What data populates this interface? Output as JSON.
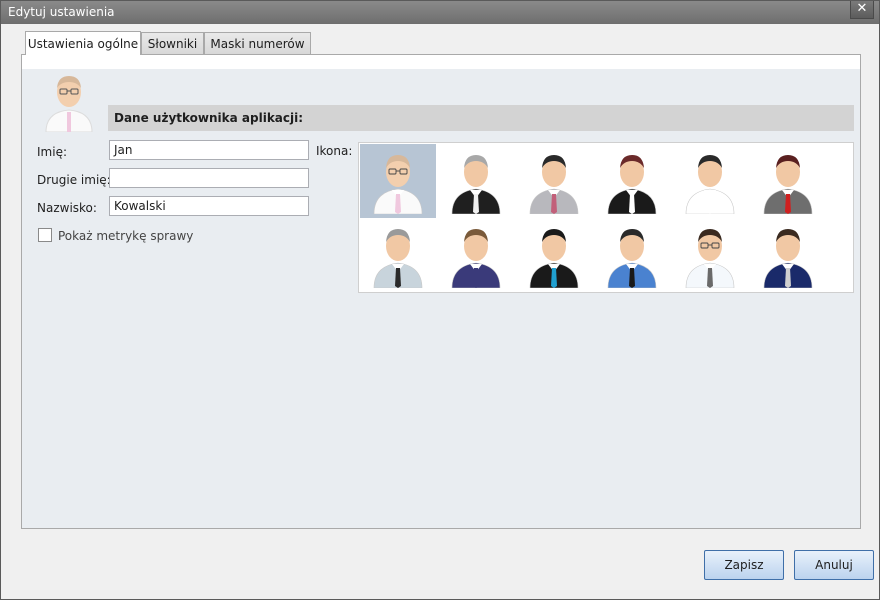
{
  "window": {
    "title": "Edytuj ustawienia",
    "close_glyph": "✕"
  },
  "tabs": [
    {
      "label": "Ustawienia ogólne",
      "active": true
    },
    {
      "label": "Słowniki",
      "active": false
    },
    {
      "label": "Maski numerów",
      "active": false
    }
  ],
  "section": {
    "header": "Dane użytkownika aplikacji:"
  },
  "form": {
    "first_name_label": "Imię:",
    "first_name_value": "Jan",
    "middle_name_label": "Drugie imię:",
    "middle_name_value": "",
    "last_name_label": "Nazwisko:",
    "last_name_value": "Kowalski",
    "show_metric_label": "Pokaż metrykę sprawy",
    "show_metric_checked": false,
    "icon_label": "Ikona:"
  },
  "icons": {
    "selected_index": 0,
    "items": [
      {
        "name": "user-icon-1",
        "hair": "#d7b89a",
        "skin": "#f3cfae",
        "suit": "#fafafa",
        "tie": "#f0c8de",
        "glasses": true
      },
      {
        "name": "user-icon-2",
        "hair": "#a8a8a8",
        "skin": "#f1c8a4",
        "suit": "#1f1f1f",
        "tie": "#f0f0f0",
        "glasses": false
      },
      {
        "name": "user-icon-3",
        "hair": "#2a2a2a",
        "skin": "#f1c8a4",
        "suit": "#b8b8bd",
        "tie": "#c2607a",
        "glasses": false
      },
      {
        "name": "user-icon-4",
        "hair": "#6b2a2a",
        "skin": "#f1c8a4",
        "suit": "#1a1a1a",
        "tie": "#ffffff",
        "glasses": false
      },
      {
        "name": "user-icon-5",
        "hair": "#2a2a2a",
        "skin": "#f1c8a4",
        "suit": "#ffffff",
        "tie": "#ffffff",
        "glasses": false
      },
      {
        "name": "user-icon-6",
        "hair": "#5a2020",
        "skin": "#f1c8a4",
        "suit": "#6e6e6e",
        "tie": "#d02020",
        "glasses": false
      },
      {
        "name": "user-icon-7",
        "hair": "#9a9a9a",
        "skin": "#f1c8a4",
        "suit": "#c8d4dc",
        "tie": "#2a2a2a",
        "glasses": false
      },
      {
        "name": "user-icon-8",
        "hair": "#7a5a3a",
        "skin": "#f1c8a4",
        "suit": "#3a3a7a",
        "tie": "#3a3a7a",
        "glasses": false
      },
      {
        "name": "user-icon-9",
        "hair": "#1a1a1a",
        "skin": "#f1c8a4",
        "suit": "#1a1a1a",
        "tie": "#20a0d0",
        "glasses": false
      },
      {
        "name": "user-icon-10",
        "hair": "#2a2a2a",
        "skin": "#f1c8a4",
        "suit": "#4a82d0",
        "tie": "#1a1a1a",
        "glasses": false
      },
      {
        "name": "user-icon-11",
        "hair": "#3a2a20",
        "skin": "#f1c8a4",
        "suit": "#f4f8fc",
        "tie": "#6a6a6a",
        "glasses": true
      },
      {
        "name": "user-icon-12",
        "hair": "#3a2a20",
        "skin": "#f1c8a4",
        "suit": "#1a2a6a",
        "tie": "#d0d0d0",
        "glasses": false
      }
    ]
  },
  "buttons": {
    "save": "Zapisz",
    "cancel": "Anuluj"
  }
}
